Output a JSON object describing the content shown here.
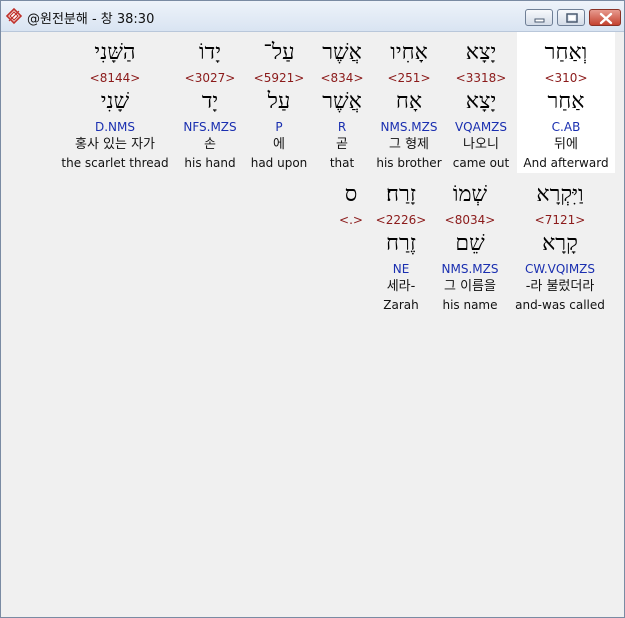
{
  "window": {
    "title": "@원전분해 - 창 38:30"
  },
  "row1": [
    {
      "hebrew": "וְאַחַר",
      "strong": "<310>",
      "hebrew_lemma": "אַחַר",
      "morph": "C.AB",
      "korean": "뒤에",
      "english": "And afterward",
      "highlighted": true
    },
    {
      "hebrew": "יָצָא",
      "strong": "<3318>",
      "hebrew_lemma": "יָצָא",
      "morph": "VQAMZS",
      "korean": "나오니",
      "english": "came out"
    },
    {
      "hebrew": "אָחִיו",
      "strong": "<251>",
      "hebrew_lemma": "אָח",
      "morph": "NMS.MZS",
      "korean": "그 형제",
      "english": "his brother"
    },
    {
      "hebrew": "אֲשֶׁר",
      "strong": "<834>",
      "hebrew_lemma": "אֲשֶׁר",
      "morph": "R",
      "korean": "곧",
      "english": "that"
    },
    {
      "hebrew": "עַל־",
      "strong": "<5921>",
      "hebrew_lemma": "עַל",
      "morph": "P",
      "korean": "에",
      "english": "had upon"
    },
    {
      "hebrew": "יָדוֹ",
      "strong": "<3027>",
      "hebrew_lemma": "יָד",
      "morph": "NFS.MZS",
      "korean": "손",
      "english": "his hand"
    },
    {
      "hebrew": "הַשָּׁנִי",
      "strong": "<8144>",
      "hebrew_lemma": "שָׁנִי",
      "morph": "D.NMS",
      "korean": "홍사 있는 자가",
      "english": "the scarlet thread"
    }
  ],
  "row2": [
    {
      "hebrew": "וַיִּקְרָא",
      "strong": "<7121>",
      "hebrew_lemma": "קָרָא",
      "morph": "CW.VQIMZS",
      "korean": "-라 불렀더라",
      "english": "and-was called"
    },
    {
      "hebrew": "שְׁמוֹ",
      "strong": "<8034>",
      "hebrew_lemma": "שֵׁם",
      "morph": "NMS.MZS",
      "korean": "그 이름을",
      "english": "his name"
    },
    {
      "hebrew": "זָרַח׃",
      "strong": "<2226>",
      "hebrew_lemma": "זֶרַח",
      "morph": "NE",
      "korean": "세라-",
      "english": "Zarah"
    },
    {
      "hebrew": "ס",
      "strong": "<.>"
    }
  ],
  "colors": {
    "strong": "#8b1a1a",
    "morph": "#1a2fb0",
    "highlight": "#ffffff",
    "background": "#f0f0f0"
  },
  "icons": {
    "app": "bible-app-icon",
    "minimize": "minimize-icon",
    "maximize": "maximize-icon",
    "close": "close-icon"
  }
}
